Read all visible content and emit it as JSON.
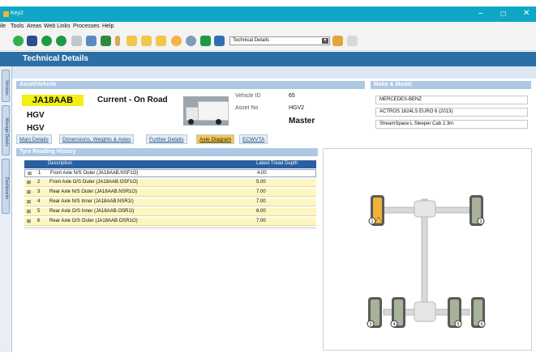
{
  "window": {
    "title": "Key2"
  },
  "menu": [
    "ile",
    "Tools",
    "Areas",
    "Web Links",
    "Processes",
    "Help"
  ],
  "toolbar": {
    "view_select": "Technical Details"
  },
  "header": {
    "title": "Technical Details"
  },
  "side_tabs": [
    "Vehicles",
    "Manage Details",
    "Dashboards"
  ],
  "asset_vehicle": {
    "heading": "Asset/Vehicle",
    "registration": "JA18AAB",
    "status": "Current - On Road",
    "type_1": "HGV",
    "type_2": "HGV",
    "vehicle_id_label": "Vehicle ID",
    "vehicle_id": "65",
    "asset_no_label": "Asset No",
    "asset_no": "HGV2",
    "role": "Master"
  },
  "make_model": {
    "heading": "Make & Model",
    "make": "MERCEDES-BENZ",
    "model": "ACTROS 1824LS EURO 6 (2013)",
    "body": "StreamSpace L Sleeper Cab 2.3m"
  },
  "tabs": [
    "Main Details",
    "Dimensions, Weights & Axles",
    "Further Details",
    "Axle Diagram",
    "ECWVTA"
  ],
  "active_tab": "Axle Diagram",
  "tyre_history": {
    "heading": "Tyre Reading History",
    "columns": [
      "Description",
      "Latest Tread Depth"
    ],
    "rows": [
      {
        "n": "1",
        "desc": "Front Axle  N/S Outer (JA18AAB.NSF1O)",
        "depth": "4.00"
      },
      {
        "n": "2",
        "desc": "Front Axle  O/S Outer (JA18AAB.OSF1O)",
        "depth": "5.00"
      },
      {
        "n": "3",
        "desc": "Rear Axle  N/S Outer (JA18AAB.NSR1O)",
        "depth": "7.00"
      },
      {
        "n": "4",
        "desc": "Rear Axle  N/S Inner (JA18AAB.NSR1I)",
        "depth": "7.00"
      },
      {
        "n": "5",
        "desc": "Rear Axle  O/S Inner (JA18AAB.OSR1I)",
        "depth": "6.00"
      },
      {
        "n": "6",
        "desc": "Rear Axle  O/S Outer (JA18AAB.OSR1O)",
        "depth": "7.00"
      }
    ]
  },
  "axle_diagram": {
    "wheel_labels": [
      "1",
      "2",
      "3",
      "4",
      "5",
      "6"
    ]
  }
}
